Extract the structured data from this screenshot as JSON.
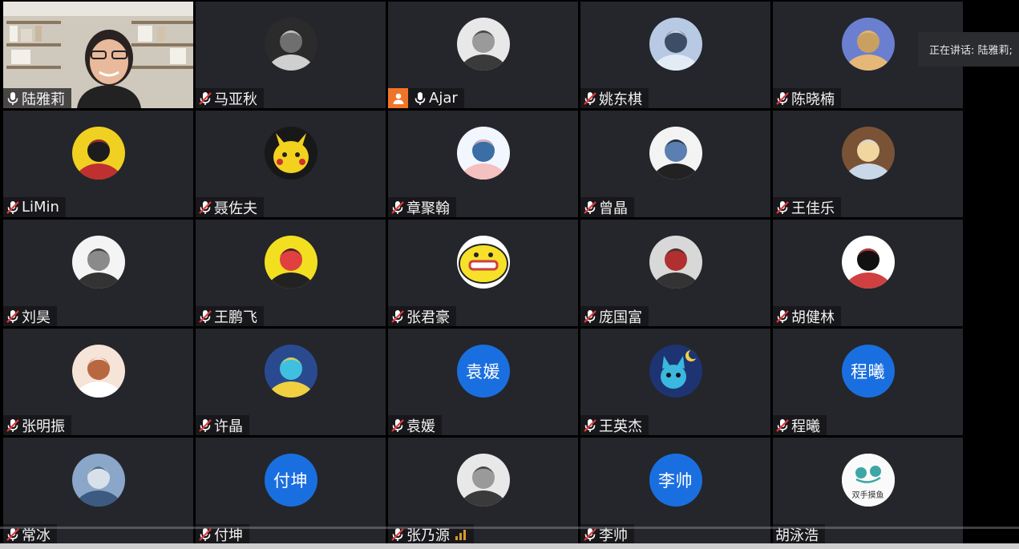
{
  "speaker_banner": {
    "text": "正在讲话: 陆雅莉;"
  },
  "participants": [
    {
      "name": "陆雅莉",
      "mic": "on",
      "avatar": "video",
      "avatar_icon": "video-feed-icon"
    },
    {
      "name": "马亚秋",
      "mic": "muted",
      "avatar": "photo",
      "avatar_icon": "photo-avatar-icon"
    },
    {
      "name": "Ajar",
      "mic": "on",
      "avatar": "photo",
      "avatar_icon": "photo-avatar-icon",
      "host": true
    },
    {
      "name": "姚东棋",
      "mic": "muted",
      "avatar": "photo",
      "avatar_icon": "photo-avatar-icon"
    },
    {
      "name": "陈晓楠",
      "mic": "muted",
      "avatar": "photo",
      "avatar_icon": "photo-avatar-icon"
    },
    {
      "name": "LiMin",
      "mic": "muted",
      "avatar": "photo",
      "avatar_icon": "cartoon-avatar-icon"
    },
    {
      "name": "聂佐夫",
      "mic": "muted",
      "avatar": "photo",
      "avatar_icon": "pikachu-avatar-icon"
    },
    {
      "name": "章聚翰",
      "mic": "muted",
      "avatar": "photo",
      "avatar_icon": "pig-avatar-icon"
    },
    {
      "name": "曾晶",
      "mic": "muted",
      "avatar": "photo",
      "avatar_icon": "anime-avatar-icon"
    },
    {
      "name": "王佳乐",
      "mic": "muted",
      "avatar": "photo",
      "avatar_icon": "anime-avatar-icon"
    },
    {
      "name": "刘昊",
      "mic": "muted",
      "avatar": "photo",
      "avatar_icon": "cartoon-avatar-icon"
    },
    {
      "name": "王鹏飞",
      "mic": "muted",
      "avatar": "photo",
      "avatar_icon": "sketch-avatar-icon"
    },
    {
      "name": "张君豪",
      "mic": "muted",
      "avatar": "photo",
      "avatar_icon": "emoji-avatar-icon"
    },
    {
      "name": "庞国富",
      "mic": "muted",
      "avatar": "photo",
      "avatar_icon": "photo-avatar-icon"
    },
    {
      "name": "胡健林",
      "mic": "muted",
      "avatar": "photo",
      "avatar_icon": "photo-avatar-icon"
    },
    {
      "name": "张明振",
      "mic": "muted",
      "avatar": "photo",
      "avatar_icon": "cartoon-avatar-icon"
    },
    {
      "name": "许晶",
      "mic": "muted",
      "avatar": "photo",
      "avatar_icon": "anime-avatar-icon"
    },
    {
      "name": "袁媛",
      "mic": "muted",
      "avatar": "text",
      "avatar_text": "袁媛"
    },
    {
      "name": "王英杰",
      "mic": "muted",
      "avatar": "photo",
      "avatar_icon": "cartoon-cat-avatar-icon"
    },
    {
      "name": "程曦",
      "mic": "muted",
      "avatar": "text",
      "avatar_text": "程曦"
    },
    {
      "name": "常冰",
      "mic": "muted",
      "avatar": "photo",
      "avatar_icon": "sketch-avatar-icon"
    },
    {
      "name": "付坤",
      "mic": "muted",
      "avatar": "text",
      "avatar_text": "付坤"
    },
    {
      "name": "张乃源",
      "mic": "muted",
      "avatar": "photo",
      "avatar_icon": "anime-avatar-icon",
      "signal": true
    },
    {
      "name": "李帅",
      "mic": "muted",
      "avatar": "text",
      "avatar_text": "李帅"
    },
    {
      "name": "胡泳浩",
      "mic": "none",
      "avatar": "photo",
      "avatar_icon": "photo-avatar-icon",
      "avatar_text": "双手摸鱼"
    }
  ],
  "colors": {
    "tile_bg": "#24262b",
    "text_avatar_bg": "#1a6fe0",
    "host_badge": "#f07427",
    "speaking_outline": "#2e8b3e"
  }
}
